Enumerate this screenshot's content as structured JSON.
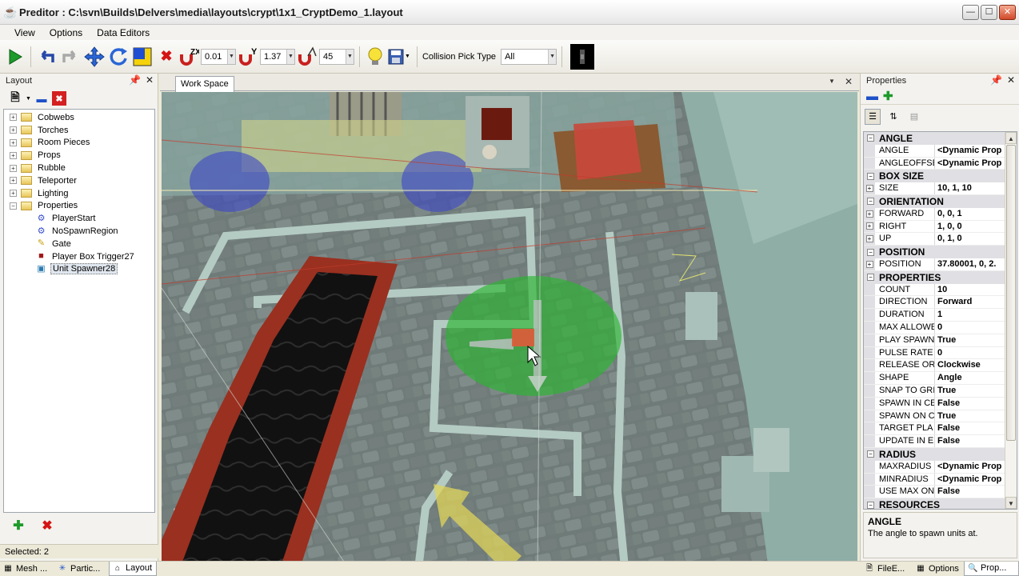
{
  "window": {
    "title": "Preditor : C:\\svn\\Builds\\Delvers\\media\\layouts\\crypt\\1x1_CryptDemo_1.layout",
    "minimize": "—",
    "maximize": "☐",
    "close": "✕"
  },
  "menu": [
    "View",
    "Options",
    "Data Editors"
  ],
  "toolbar": {
    "play_icon": "play-icon",
    "undo_icon": "undo-icon",
    "redo_icon": "redo-icon",
    "move_icon": "move-icon",
    "rotate_icon": "rotate-icon",
    "scale_icon": "scale-icon",
    "delete_icon": "delete-icon",
    "snap_zx": "0.01",
    "snap_y": "1.37",
    "snap_angle": "45",
    "collision_label": "Collision Pick Type",
    "collision_value": "All"
  },
  "layout_panel": {
    "title": "Layout",
    "pin": "↕",
    "close": "✕",
    "folders": [
      "Cobwebs",
      "Torches",
      "Room Pieces",
      "Props",
      "Rubble",
      "Teleporter",
      "Lighting",
      "Properties"
    ],
    "children": [
      {
        "label": "PlayerStart",
        "icon": "gear-icon"
      },
      {
        "label": "NoSpawnRegion",
        "icon": "gear-icon"
      },
      {
        "label": "Gate",
        "icon": "pencil-icon"
      },
      {
        "label": "Player Box Trigger27",
        "icon": "cube-icon"
      },
      {
        "label": "Unit Spawner28",
        "icon": "spawner-icon"
      }
    ],
    "selected_index": 4,
    "status": "Selected: 2"
  },
  "workspace": {
    "tab": "Work Space",
    "dropdown": "▼",
    "close": "✕"
  },
  "properties_panel": {
    "title": "Properties",
    "pin": "↕",
    "close": "✕",
    "categories": [
      {
        "name": "ANGLE",
        "rows": [
          {
            "name": "ANGLE",
            "value": "<Dynamic Prop",
            "expand": false
          },
          {
            "name": "ANGLEOFFSE",
            "value": "<Dynamic Prop",
            "expand": false
          }
        ]
      },
      {
        "name": "BOX SIZE",
        "rows": [
          {
            "name": "SIZE",
            "value": "10, 1, 10",
            "expand": true
          }
        ]
      },
      {
        "name": "ORIENTATION",
        "rows": [
          {
            "name": "FORWARD",
            "value": "0, 0, 1",
            "expand": true
          },
          {
            "name": "RIGHT",
            "value": "1, 0, 0",
            "expand": true
          },
          {
            "name": "UP",
            "value": "0, 1, 0",
            "expand": true
          }
        ]
      },
      {
        "name": "POSITION",
        "rows": [
          {
            "name": "POSITION",
            "value": "37.80001, 0, 2.",
            "expand": true
          }
        ]
      },
      {
        "name": "PROPERTIES",
        "rows": [
          {
            "name": "COUNT",
            "value": "10",
            "expand": false
          },
          {
            "name": "DIRECTION",
            "value": "Forward",
            "expand": false
          },
          {
            "name": "DURATION",
            "value": "1",
            "expand": false
          },
          {
            "name": "MAX ALLOWE",
            "value": "0",
            "expand": false
          },
          {
            "name": "PLAY SPAWN",
            "value": "True",
            "expand": false
          },
          {
            "name": "PULSE RATE",
            "value": "0",
            "expand": false
          },
          {
            "name": "RELEASE OR",
            "value": "Clockwise",
            "expand": false
          },
          {
            "name": "SHAPE",
            "value": "Angle",
            "expand": false
          },
          {
            "name": "SNAP TO GRI",
            "value": "True",
            "expand": false
          },
          {
            "name": "SPAWN IN CE",
            "value": "False",
            "expand": false
          },
          {
            "name": "SPAWN ON C",
            "value": "True",
            "expand": false
          },
          {
            "name": "TARGET PLA",
            "value": "False",
            "expand": false
          },
          {
            "name": "UPDATE IN E",
            "value": "False",
            "expand": false
          }
        ]
      },
      {
        "name": "RADIUS",
        "rows": [
          {
            "name": "MAXRADIUS",
            "value": "<Dynamic Prop",
            "expand": false
          },
          {
            "name": "MINRADIUS",
            "value": "<Dynamic Prop",
            "expand": false
          },
          {
            "name": "USE MAX ON",
            "value": "False",
            "expand": false
          }
        ]
      },
      {
        "name": "RESOURCES",
        "rows": []
      }
    ],
    "description_title": "ANGLE",
    "description_text": "The angle to spawn units at."
  },
  "bottom_tabs": [
    {
      "label": "Mesh ...",
      "icon": "mesh-icon"
    },
    {
      "label": "Partic...",
      "icon": "particle-icon"
    },
    {
      "label": "Layout",
      "icon": "home-icon"
    },
    {
      "label": "FileE...",
      "icon": "file-icon"
    },
    {
      "label": "Options",
      "icon": "options-icon"
    },
    {
      "label": "Prop...",
      "icon": "properties-icon"
    }
  ],
  "colors": {
    "spawner_green": "#29b52f",
    "trigger_blue": "#3c46c8",
    "floor_stone": "#6e7a78",
    "wall_teal": "#8fb0a8",
    "carpet_red": "#8b1f12"
  }
}
